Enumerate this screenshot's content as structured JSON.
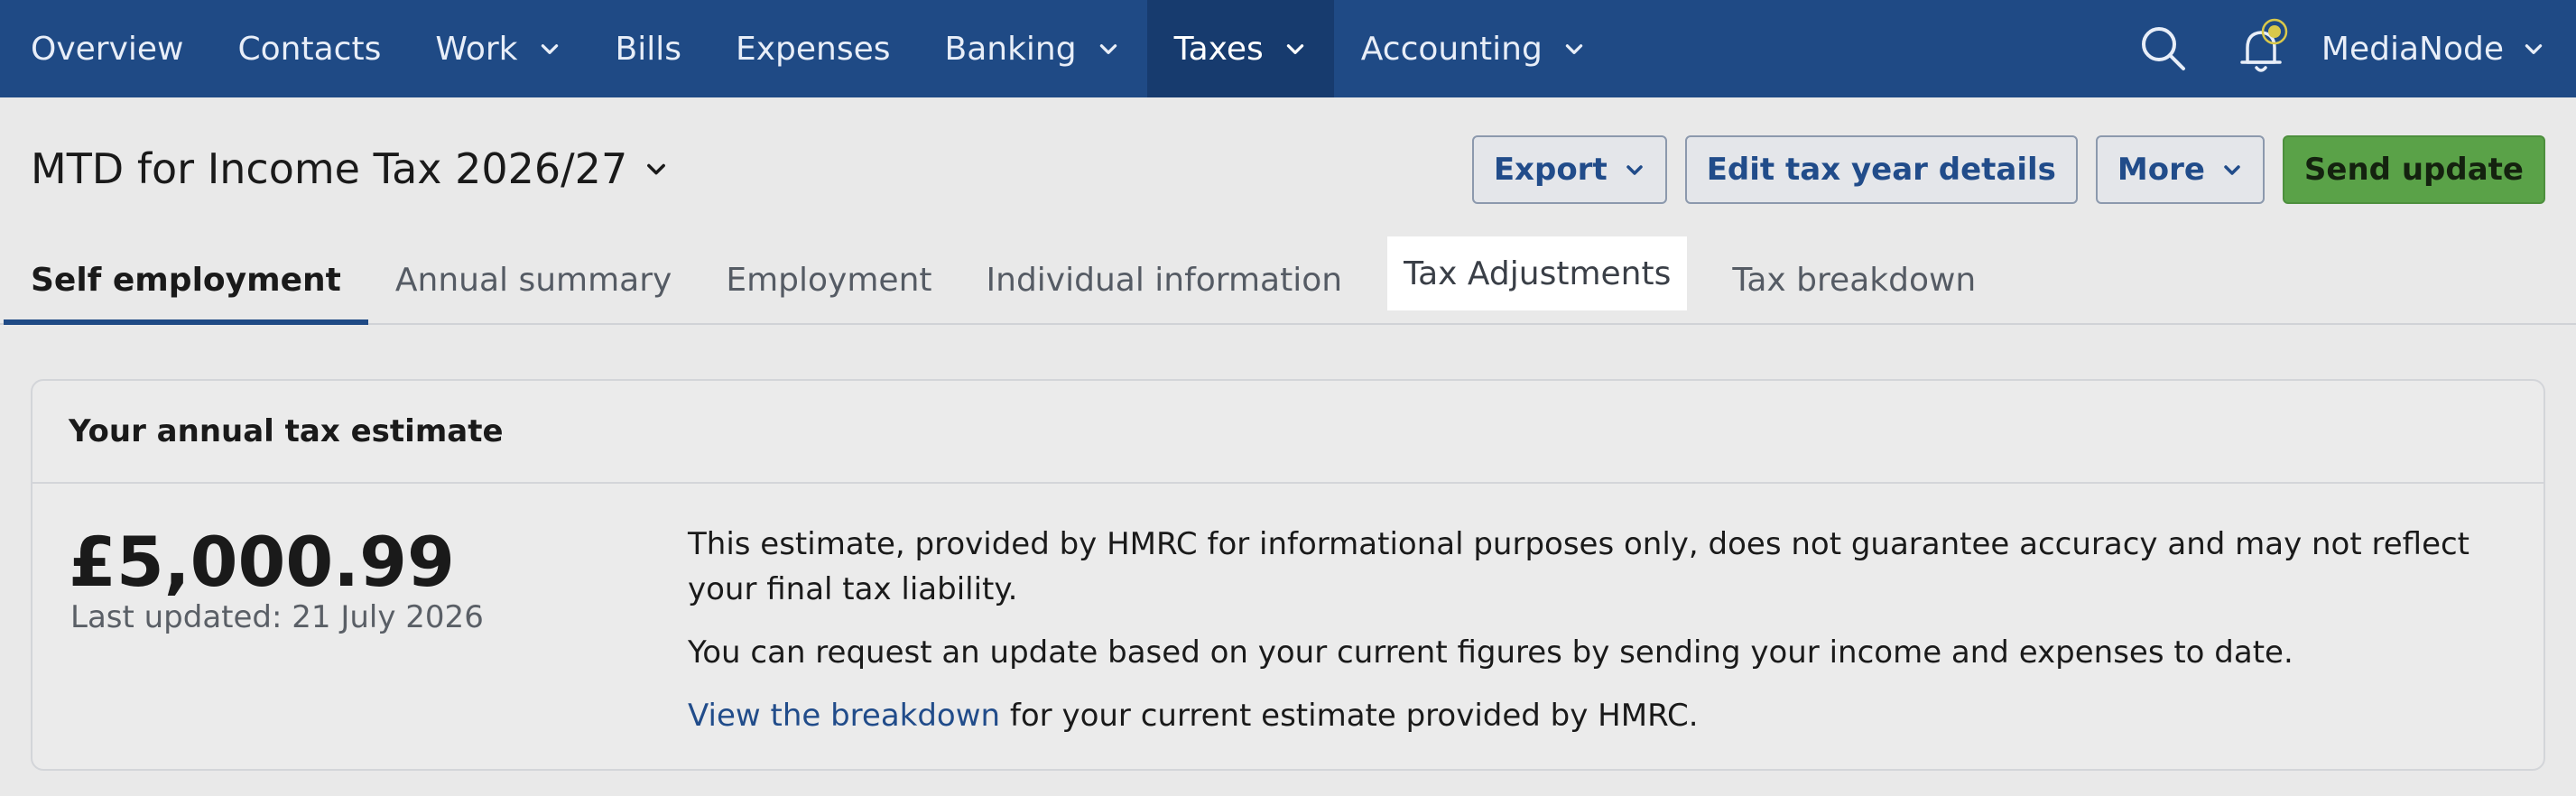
{
  "topnav": {
    "items": [
      {
        "label": "Overview"
      },
      {
        "label": "Contacts"
      },
      {
        "label": "Work"
      },
      {
        "label": "Bills"
      },
      {
        "label": "Expenses"
      },
      {
        "label": "Banking"
      },
      {
        "label": "Taxes"
      },
      {
        "label": "Accounting"
      }
    ],
    "account": "MediaNode",
    "icons": [
      "search-icon",
      "bell-icon",
      "chevron-down-icon"
    ],
    "colors": {
      "bar": "#1f4a85",
      "active": "#173b6e",
      "notification": "#d9c84a"
    }
  },
  "header": {
    "title": "MTD for Income Tax 2026/27",
    "buttons": {
      "export": "Export",
      "edit": "Edit tax year details",
      "more": "More",
      "send": "Send update"
    }
  },
  "tabs": [
    {
      "label": "Self employment"
    },
    {
      "label": "Annual summary"
    },
    {
      "label": "Employment"
    },
    {
      "label": "Individual information"
    },
    {
      "label": "Tax Adjustments"
    },
    {
      "label": "Tax breakdown"
    }
  ],
  "estimate": {
    "heading": "Your annual tax estimate",
    "amount": "£5,000.99",
    "last_updated": "Last updated: 21 July 2026",
    "paragraph1": "This estimate, provided by HMRC for informational purposes only, does not guarantee accuracy and may not reflect your final tax liability.",
    "paragraph2": "You can request an update based on your current figures by sending your income and expenses to date.",
    "link_text": "View the breakdown",
    "link_suffix": " for your current estimate provided by HMRC."
  }
}
